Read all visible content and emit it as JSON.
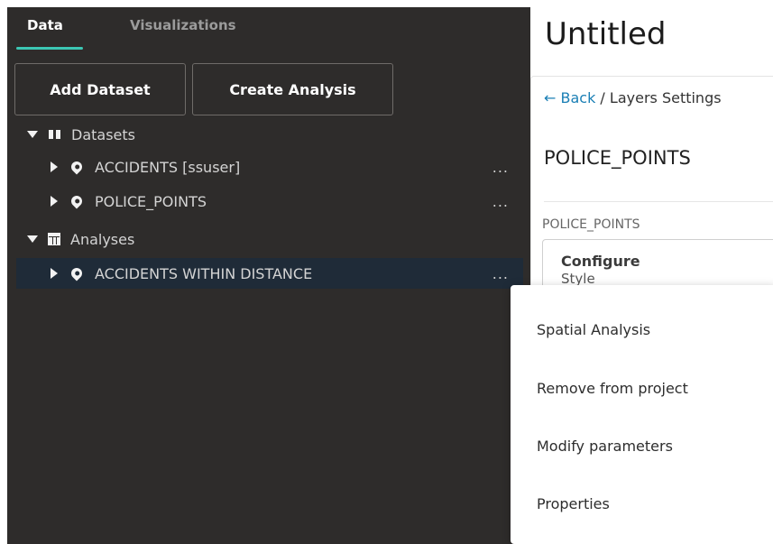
{
  "tabs": [
    {
      "label": "Data",
      "active": true
    },
    {
      "label": "Visualizations",
      "active": false
    }
  ],
  "buttons": {
    "add_dataset": "Add Dataset",
    "create_analysis": "Create Analysis"
  },
  "tree": {
    "datasets": {
      "label": "Datasets",
      "icon": "book-icon",
      "items": [
        {
          "label": "ACCIDENTS [ssuser]",
          "icon": "map-pin-icon",
          "more": "..."
        },
        {
          "label": "POLICE_POINTS",
          "icon": "map-pin-icon",
          "more": "..."
        }
      ]
    },
    "analyses": {
      "label": "Analyses",
      "icon": "table-icon",
      "items": [
        {
          "label": "ACCIDENTS WITHIN DISTANCE",
          "icon": "map-pin-icon",
          "more": "...",
          "selected": true
        }
      ]
    }
  },
  "right_panel": {
    "title": "Untitled",
    "breadcrumb": {
      "back": "← Back",
      "separator": " / ",
      "current": "Layers Settings"
    },
    "layer_title": "POLICE_POINTS",
    "layer_label": "POLICE_POINTS",
    "configure": {
      "title": "Configure",
      "subtitle": "Style"
    }
  },
  "context_menu": {
    "items": [
      "Spatial Analysis",
      "Remove from project",
      "Modify parameters",
      "Properties"
    ]
  },
  "colors": {
    "panel_bg": "#2e2c2b",
    "accent": "#3cc7b4",
    "selected_row": "#1f2b38",
    "link": "#1a7fb5"
  }
}
